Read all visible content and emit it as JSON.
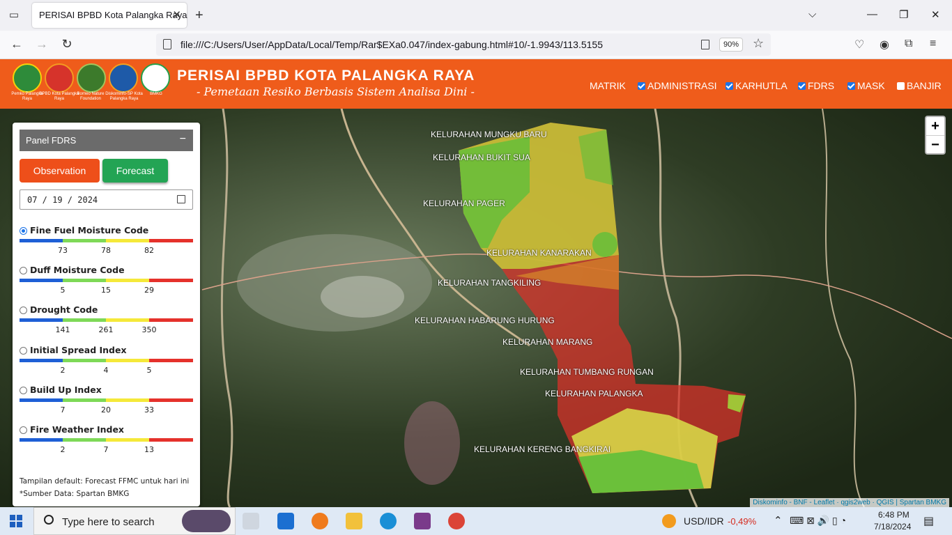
{
  "browser": {
    "tab_title": "PERISAI BPBD Kota Palangka Raya",
    "url": "file:///C:/Users/User/AppData/Local/Temp/Rar$EXa0.047/index-gabung.html#10/-1.9943/113.5155",
    "zoom": "90%"
  },
  "header": {
    "title": "PERISAI BPBD KOTA PALANGKA RAYA",
    "subtitle": "- Pemetaan Resiko Berbasis Sistem Analisa Dini -",
    "logos": [
      {
        "caption": "Pemko Palangka Raya"
      },
      {
        "caption": "BPBD Kota Palangka Raya"
      },
      {
        "caption": "Borneo Nature Foundation"
      },
      {
        "caption": "Diskominfo-SP Kota Palangka Raya"
      },
      {
        "caption": "BMKG"
      }
    ],
    "menu": [
      {
        "label": "MATRIK",
        "checkbox": false
      },
      {
        "label": "ADMINISTRASI",
        "checkbox": true,
        "checked": true
      },
      {
        "label": "KARHUTLA",
        "checkbox": true,
        "checked": true
      },
      {
        "label": "FDRS",
        "checkbox": true,
        "checked": true
      },
      {
        "label": "MASK",
        "checkbox": true,
        "checked": true
      },
      {
        "label": "BANJIR",
        "checkbox": true,
        "checked": false
      }
    ]
  },
  "panel": {
    "title": "Panel FDRS",
    "observation_label": "Observation",
    "forecast_label": "Forecast",
    "date": "07 / 19 / 2024",
    "indices": [
      {
        "label": "Fine Fuel Moisture Code",
        "selected": true,
        "ticks": [
          "73",
          "78",
          "82"
        ]
      },
      {
        "label": "Duff Moisture Code",
        "selected": false,
        "ticks": [
          "5",
          "15",
          "29"
        ]
      },
      {
        "label": "Drought Code",
        "selected": false,
        "ticks": [
          "141",
          "261",
          "350"
        ]
      },
      {
        "label": "Initial Spread Index",
        "selected": false,
        "ticks": [
          "2",
          "4",
          "5"
        ]
      },
      {
        "label": "Build Up Index",
        "selected": false,
        "ticks": [
          "7",
          "20",
          "33"
        ]
      },
      {
        "label": "Fire Weather Index",
        "selected": false,
        "ticks": [
          "2",
          "7",
          "13"
        ]
      }
    ],
    "scale_colors": [
      "#1e5fd6",
      "#7ed957",
      "#f5e93a",
      "#e5312b"
    ],
    "note": "Tampilan default: Forecast FFMC untuk hari ini",
    "source": "*Sumber Data: Spartan BMKG"
  },
  "map": {
    "labels": [
      "KELURAHAN MUNGKU BARU",
      "KELURAHAN BUKIT SUA",
      "KELURAHAN PAGER",
      "KELURAHAN KANARAKAN",
      "KELURAHAN TANGKILING",
      "KELURAHAN HABARUNG HURUNG",
      "KELURAHAN MARANG",
      "KELURAHAN TUMBANG RUNGAN",
      "KELURAHAN PALANGKA",
      "KELURAHAN KERENG BANGKIRAI"
    ],
    "attribution": "Diskominfo - BNF - Leaflet · qgis2web · QGIS | Spartan BMKG",
    "zoom_in": "+",
    "zoom_out": "−"
  },
  "taskbar": {
    "search_placeholder": "Type here to search",
    "currency": "USD/IDR",
    "currency_change": "-0,49%",
    "time": "6:48 PM",
    "date": "7/18/2024"
  }
}
